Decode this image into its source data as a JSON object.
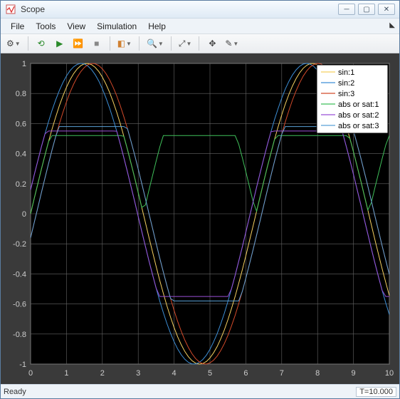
{
  "window": {
    "title": "Scope"
  },
  "menubar": {
    "file": "File",
    "tools": "Tools",
    "view": "View",
    "simulation": "Simulation",
    "help": "Help"
  },
  "toolbar": {
    "config": "⚙",
    "back": "⟲",
    "run": "▶",
    "forward": "⏩",
    "stop": "■",
    "highlight": "◧",
    "zoom": "🔍",
    "fit": "⤢",
    "cursor": "✥",
    "annot": "✎"
  },
  "status": {
    "ready": "Ready",
    "time": "T=10.000"
  },
  "chart_data": {
    "type": "line",
    "xlabel": "",
    "ylabel": "",
    "xlim": [
      0,
      10
    ],
    "ylim": [
      -1,
      1
    ],
    "xticks": [
      0,
      1,
      2,
      3,
      4,
      5,
      6,
      7,
      8,
      9,
      10
    ],
    "yticks": [
      -1,
      -0.8,
      -0.6,
      -0.4,
      -0.2,
      0,
      0.2,
      0.4,
      0.6,
      0.8,
      1
    ],
    "x": [
      0,
      0.1,
      0.2,
      0.3,
      0.4,
      0.5,
      0.6,
      0.7,
      0.8,
      0.9,
      1,
      1.1,
      1.2,
      1.3,
      1.4,
      1.5,
      1.6,
      1.7,
      1.8,
      1.9,
      2,
      2.1,
      2.2,
      2.3,
      2.4,
      2.5,
      2.6,
      2.7,
      2.8,
      2.9,
      3,
      3.1,
      3.2,
      3.3,
      3.4,
      3.5,
      3.6,
      3.7,
      3.8,
      3.9,
      4,
      4.1,
      4.2,
      4.3,
      4.4,
      4.5,
      4.6,
      4.7,
      4.8,
      4.9,
      5,
      5.1,
      5.2,
      5.3,
      5.4,
      5.5,
      5.6,
      5.7,
      5.8,
      5.9,
      6,
      6.1,
      6.2,
      6.3,
      6.4,
      6.5,
      6.6,
      6.7,
      6.8,
      6.9,
      7,
      7.1,
      7.2,
      7.3,
      7.4,
      7.5,
      7.6,
      7.7,
      7.8,
      7.9,
      8,
      8.1,
      8.2,
      8.3,
      8.4,
      8.5,
      8.6,
      8.7,
      8.8,
      8.9,
      9,
      9.1,
      9.2,
      9.3,
      9.4,
      9.5,
      9.6,
      9.7,
      9.8,
      9.9,
      10
    ],
    "series": [
      {
        "name": "sin:1",
        "color": "#f5d060",
        "phase": 0.0,
        "abs": false,
        "sat": 1.0
      },
      {
        "name": "sin:2",
        "color": "#3d8fd6",
        "phase": 0.16,
        "abs": false,
        "sat": 1.0
      },
      {
        "name": "sin:3",
        "color": "#d24a2a",
        "phase": -0.16,
        "abs": false,
        "sat": 1.0
      },
      {
        "name": "abs or sat:1",
        "color": "#3fbf5a",
        "phase": 0.0,
        "abs": true,
        "sat": 0.52
      },
      {
        "name": "abs or sat:2",
        "color": "#9a4fd6",
        "phase": 0.16,
        "abs": false,
        "sat": 0.55
      },
      {
        "name": "abs or sat:3",
        "color": "#5aa0d6",
        "phase": -0.16,
        "abs": false,
        "sat": 0.58
      }
    ],
    "legend_position": "top-right"
  }
}
